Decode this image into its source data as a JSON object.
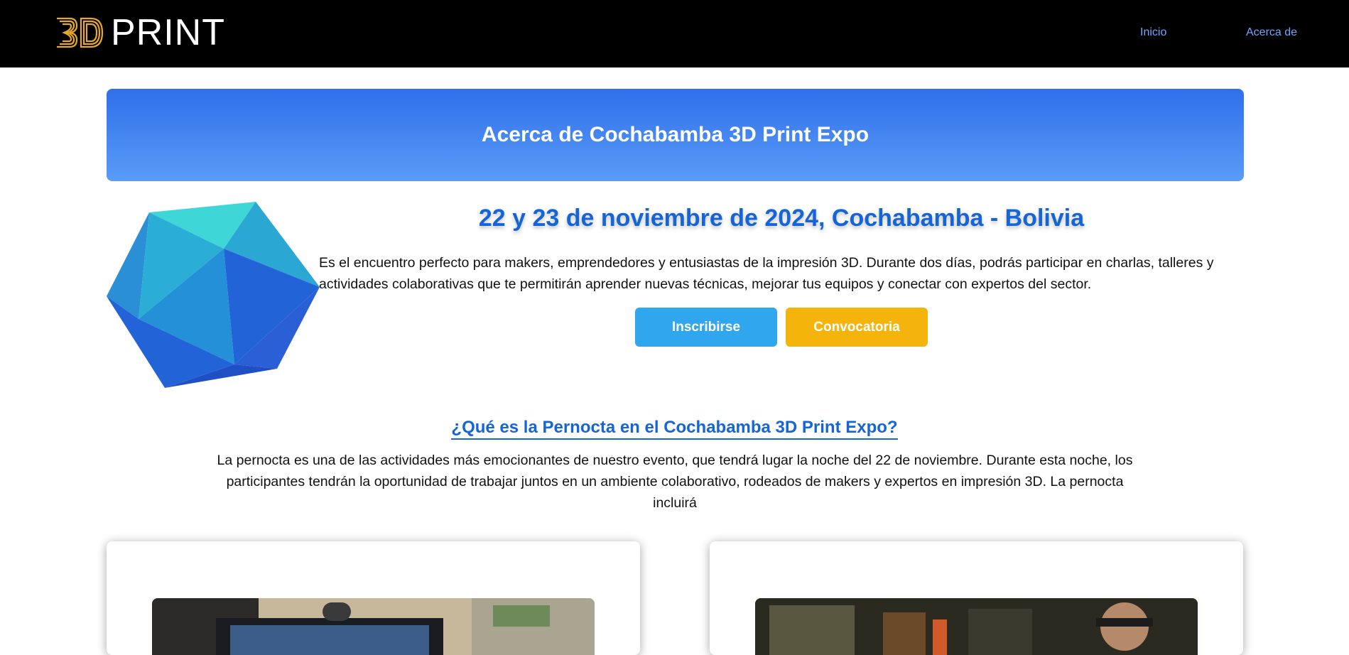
{
  "header": {
    "logo": {
      "mark": "3D",
      "text": "PRINT"
    },
    "nav": [
      {
        "label": "Inicio"
      },
      {
        "label": "Acerca de"
      }
    ]
  },
  "hero": {
    "title": "Acerca de Cochabamba 3D Print Expo"
  },
  "event": {
    "date_title": "22 y 23 de noviembre de 2024, Cochabamba - Bolivia",
    "description": "Es el encuentro perfecto para makers, emprendedores y entusiastas de la impresión 3D. Durante dos días, podrás participar en charlas, talleres y actividades colaborativas que te permitirán aprender nuevas técnicas, mejorar tus equipos y conectar con expertos del sector.",
    "buttons": {
      "register": "Inscribirse",
      "call": "Convocatoria"
    }
  },
  "pernocta": {
    "title": "¿Qué es la Pernocta en el Cochabamba 3D Print Expo?",
    "text": "La pernocta es una de las actividades más emocionantes de nuestro evento, que tendrá lugar la noche del 22 de noviembre. Durante esta noche, los participantes tendrán la oportunidad de trabajar juntos en un ambiente colaborativo, rodeados de makers y expertos en impresión 3D. La pernocta incluirá"
  },
  "colors": {
    "header_bg": "#000000",
    "nav_link": "#6ea8ff",
    "brand_gold": "#e7a92b",
    "banner_top": "#2f6fea",
    "banner_bottom": "#5a9cf7",
    "accent_blue": "#1565d8",
    "btn_register": "#2fa6ee",
    "btn_call": "#f4b40c"
  },
  "icons": {
    "logo": "3d-print-logo-icon",
    "hero_image": "icosahedron-icon"
  }
}
